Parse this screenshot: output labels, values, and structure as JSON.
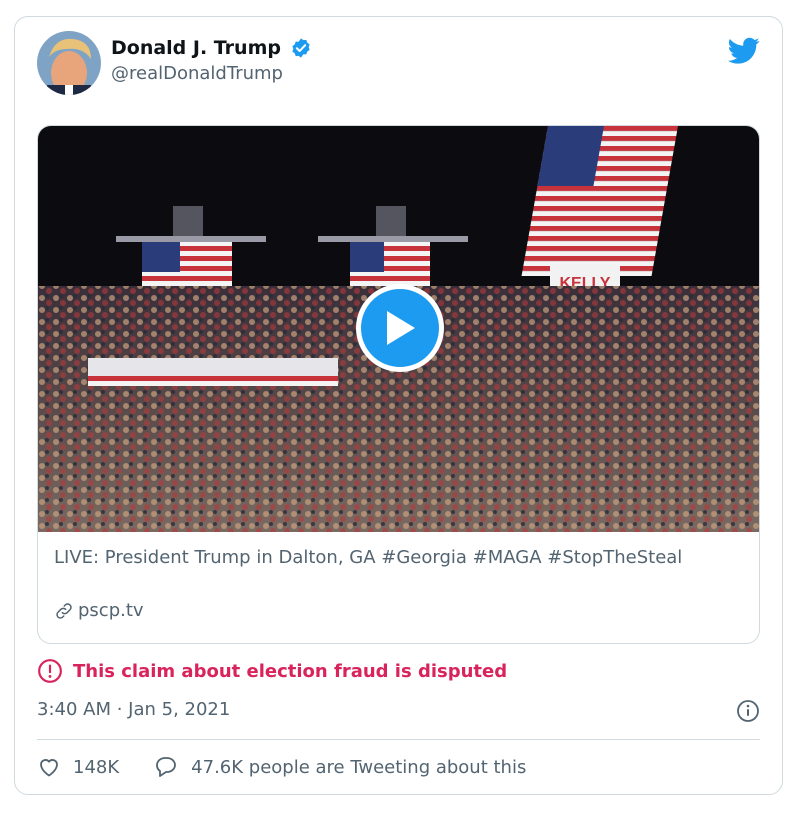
{
  "author": {
    "display_name": "Donald J. Trump",
    "handle": "@realDonaldTrump",
    "verified": true
  },
  "icons": {
    "brand": "twitter-bird-icon",
    "verified": "verified-badge-icon",
    "play": "play-icon",
    "link": "link-icon",
    "warning": "exclamation-circle-icon",
    "info": "info-icon",
    "like": "heart-icon",
    "reply": "speech-bubble-icon"
  },
  "media": {
    "link_title": "LIVE: President Trump in Dalton, GA #Georgia #MAGA #StopTheSteal",
    "domain": "pscp.tv"
  },
  "label": {
    "text": "This claim about election fraud is disputed"
  },
  "meta": {
    "timestamp": "3:40 AM · Jan 5, 2021"
  },
  "actions": {
    "likes": "148K",
    "conversation": "47.6K people are Tweeting about this"
  },
  "colors": {
    "brand_blue": "#1d9bf0",
    "warning_pink": "#d9235c",
    "secondary_text": "#536471",
    "border": "#cfd9de"
  }
}
